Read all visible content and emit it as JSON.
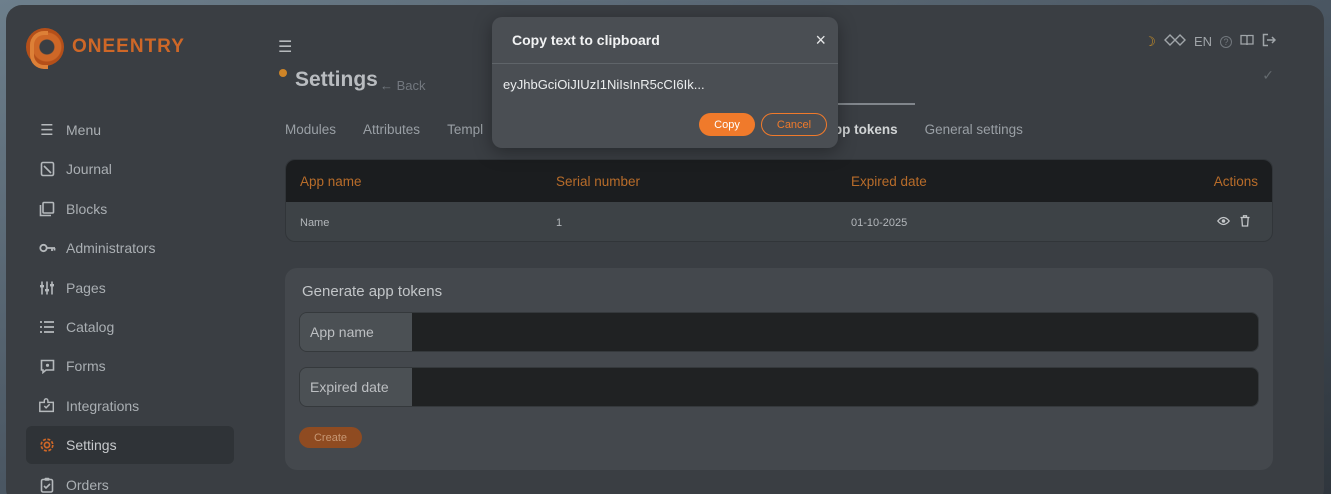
{
  "brand": {
    "name": "ONEENTRY"
  },
  "sidebar": {
    "items": [
      {
        "label": "Menu",
        "icon": "menu-icon"
      },
      {
        "label": "Journal",
        "icon": "journal-icon"
      },
      {
        "label": "Blocks",
        "icon": "blocks-icon"
      },
      {
        "label": "Administrators",
        "icon": "key-icon"
      },
      {
        "label": "Pages",
        "icon": "sliders-icon"
      },
      {
        "label": "Catalog",
        "icon": "list-icon"
      },
      {
        "label": "Forms",
        "icon": "forms-icon"
      },
      {
        "label": "Integrations",
        "icon": "puzzle-icon"
      },
      {
        "label": "Settings",
        "icon": "gear-icon",
        "active": true
      },
      {
        "label": "Orders",
        "icon": "clipboard-icon"
      }
    ]
  },
  "header": {
    "title": "Settings",
    "back_label": "Back",
    "language": "EN"
  },
  "tabs": [
    {
      "label": "Modules"
    },
    {
      "label": "Attributes"
    },
    {
      "label": "Templ"
    },
    {
      "label": "App tokens",
      "active": true
    },
    {
      "label": "General settings"
    }
  ],
  "table": {
    "columns": [
      "App name",
      "Serial number",
      "Expired date",
      "Actions"
    ],
    "rows": [
      {
        "app_name": "Name",
        "serial_number": "1",
        "expired_date": "01-10-2025"
      }
    ]
  },
  "generate": {
    "title": "Generate app tokens",
    "app_name_label": "App name",
    "app_name_value": "",
    "expired_date_label": "Expired date",
    "expired_date_value": "",
    "create_label": "Create"
  },
  "modal": {
    "title": "Copy text to clipboard",
    "token": "eyJhbGciOiJIUzI1NiIsInR5cCI6Ik...",
    "copy_label": "Copy",
    "cancel_label": "Cancel"
  },
  "colors": {
    "accent": "#f07a2b",
    "table_header_text": "#c8762e"
  }
}
